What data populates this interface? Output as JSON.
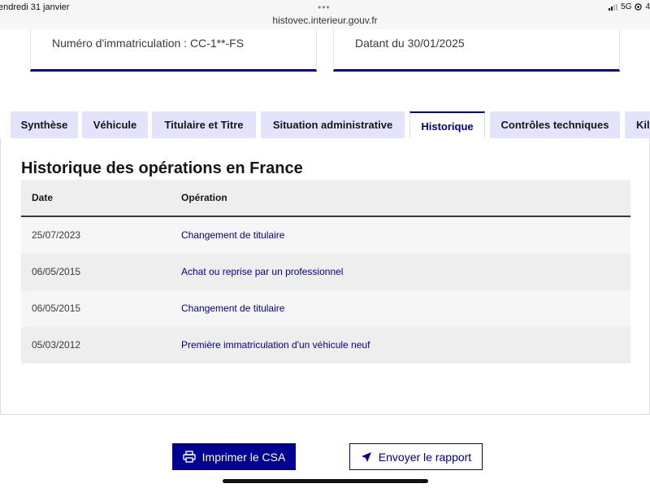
{
  "statusbar": {
    "date": "endredi 31 janvier",
    "dots": "•••",
    "url": "histovec.interieur.gouv.fr",
    "network": "5G",
    "battery": "4"
  },
  "cards": {
    "plate": "Numéro d'immatriculation : CC-1**-FS",
    "dated": "Datant du 30/01/2025"
  },
  "tabs": [
    {
      "label": "Synthèse",
      "active": false
    },
    {
      "label": "Véhicule",
      "active": false
    },
    {
      "label": "Titulaire et Titre",
      "active": false
    },
    {
      "label": "Situation administrative",
      "active": false
    },
    {
      "label": "Historique",
      "active": true
    },
    {
      "label": "Contrôles techniques",
      "active": false
    },
    {
      "label": "Kil",
      "active": false
    }
  ],
  "history": {
    "title": "Historique des opérations en France",
    "columns": {
      "date": "Date",
      "operation": "Opération"
    },
    "rows": [
      {
        "date": "25/07/2023",
        "operation": "Changement de titulaire"
      },
      {
        "date": "06/05/2015",
        "operation": "Achat ou reprise par un professionnel"
      },
      {
        "date": "06/05/2015",
        "operation": "Changement de titulaire"
      },
      {
        "date": "05/03/2012",
        "operation": "Première immatriculation d'un véhicule neuf"
      }
    ]
  },
  "actions": {
    "print_label": "Imprimer le CSA",
    "send_label": "Envoyer le rapport"
  },
  "colors": {
    "brand": "#000091",
    "tab_bg": "#e3e3fd"
  }
}
